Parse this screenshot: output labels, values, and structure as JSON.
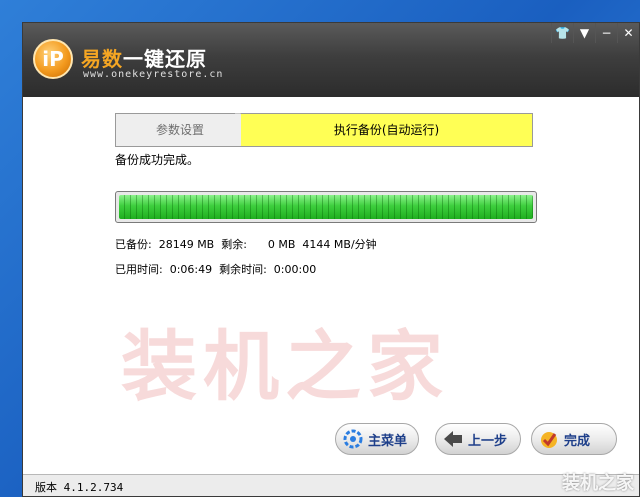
{
  "app": {
    "logo_text": "iP",
    "title_brand": "易数",
    "title_rest": "一键还原",
    "url": "www.onekeyrestore.cn"
  },
  "window_controls": [
    "👕",
    "▼",
    "−",
    "✕"
  ],
  "steps": [
    {
      "label": "参数设置",
      "active": false
    },
    {
      "label": "执行备份(自动运行)",
      "active": true
    }
  ],
  "status_message": "备份成功完成。",
  "progress": {
    "percent": 100,
    "color": "#3ecf3e"
  },
  "stats": {
    "row1": "已备份:  28149 MB  剩余:      0 MB  4144 MB/分钟",
    "row2": "已用时间:  0:06:49  剩余时间:  0:00:00"
  },
  "watermark": "装机之家",
  "buttons": {
    "main_menu": "主菜单",
    "back": "上一步",
    "finish": "完成"
  },
  "version": "版本 4.1.2.734",
  "corner_watermark": "装机之家"
}
